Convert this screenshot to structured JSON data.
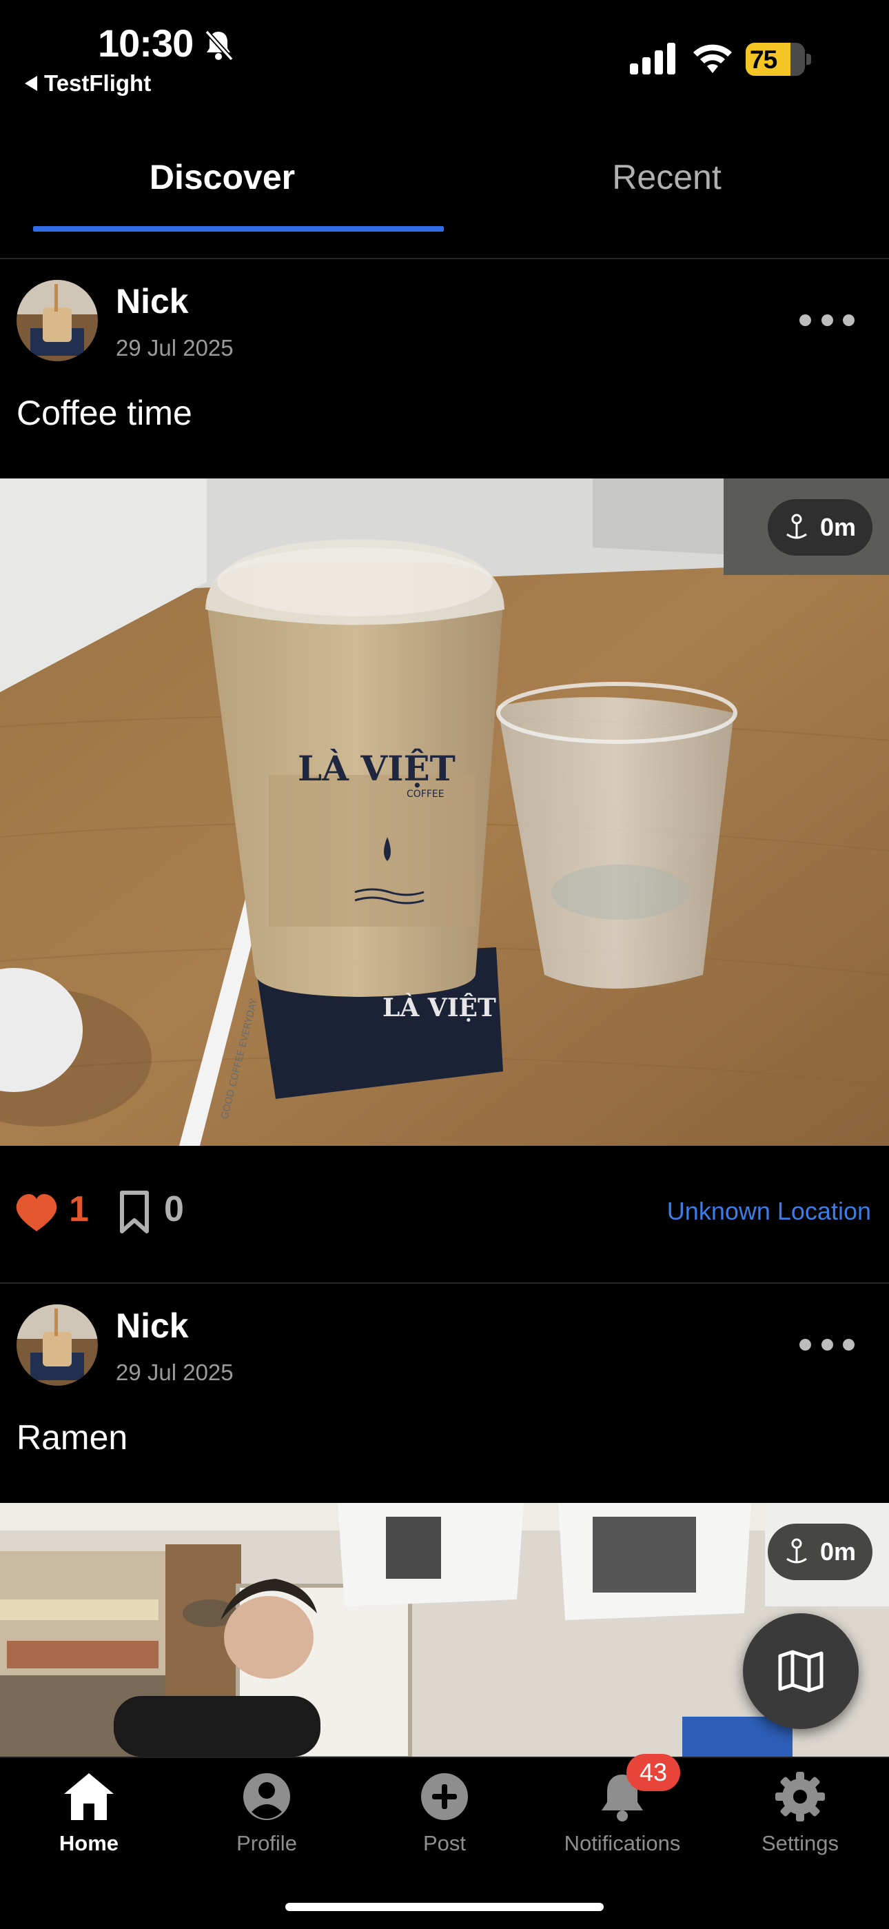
{
  "status_bar": {
    "time": "10:30",
    "back_app": "TestFlight",
    "battery_level": "75"
  },
  "tabs": [
    {
      "label": "Discover",
      "active": true
    },
    {
      "label": "Recent",
      "active": false
    }
  ],
  "posts": [
    {
      "author": "Nick",
      "date": "29 Jul 2025",
      "caption": "Coffee time",
      "distance": "0m",
      "likes": "1",
      "saves": "0",
      "location": "Unknown Location"
    },
    {
      "author": "Nick",
      "date": "29 Jul 2025",
      "caption": "Ramen",
      "distance": "0m"
    }
  ],
  "photo_text": {
    "cup_brand": "LÀ VIỆT",
    "cup_sub": "COFFEE",
    "straw_text": "GOOD COFFEE EVERYDAY"
  },
  "bottom_nav": [
    {
      "label": "Home",
      "icon": "home-icon",
      "active": true
    },
    {
      "label": "Profile",
      "icon": "person-icon"
    },
    {
      "label": "Post",
      "icon": "plus-circle-icon"
    },
    {
      "label": "Notifications",
      "icon": "bell-icon",
      "badge": "43"
    },
    {
      "label": "Settings",
      "icon": "gear-icon"
    }
  ],
  "colors": {
    "accent": "#2f6ee8",
    "like": "#e4572e",
    "link": "#3d7de6",
    "badge": "#e8443a"
  }
}
